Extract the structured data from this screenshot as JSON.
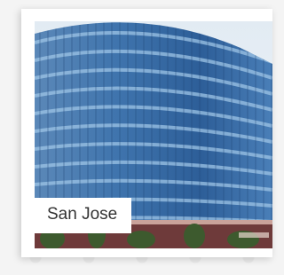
{
  "card": {
    "city_label": "San Jose",
    "image_subject": "office-building-photo"
  },
  "colors": {
    "background": "#f4f4f4",
    "card": "#ffffff",
    "label_text": "#333333",
    "sky": "#e8eef4"
  }
}
